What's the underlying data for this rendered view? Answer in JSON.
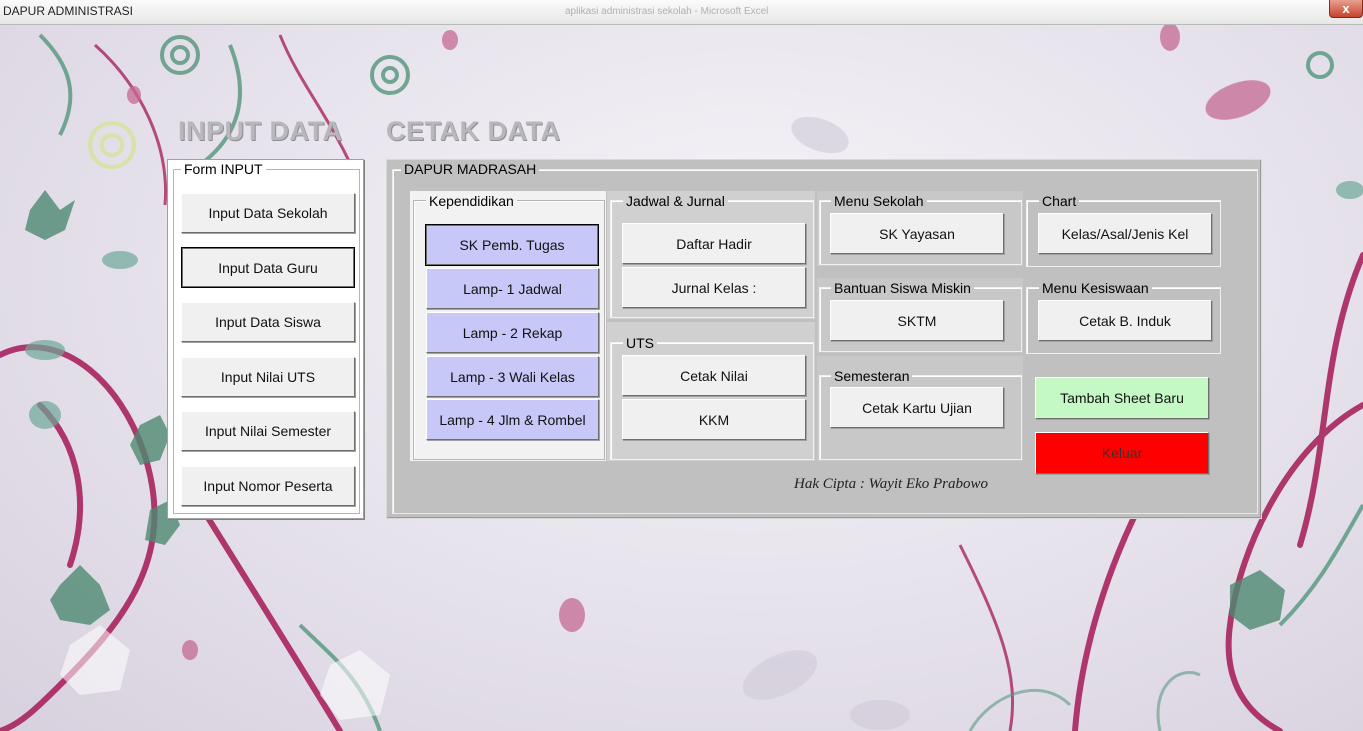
{
  "window": {
    "title": "DAPUR ADMINISTRASI",
    "faint_title": "aplikasi administrasi sekolah - Microsoft Excel",
    "close_glyph": "x"
  },
  "headers": {
    "input_data": "INPUT DATA",
    "cetak_data": "CETAK DATA"
  },
  "form_input": {
    "legend": "Form INPUT",
    "buttons": [
      "Input Data Sekolah",
      "Input Data Guru",
      "Input Data Siswa",
      "Input Nilai UTS",
      "Input Nilai Semester",
      "Input Nomor Peserta"
    ]
  },
  "dapur": {
    "legend": "DAPUR MADRASAH",
    "kependidikan": {
      "legend": "Kependidikan",
      "buttons": [
        "SK Pemb. Tugas",
        "Lamp- 1 Jadwal",
        "Lamp - 2 Rekap",
        "Lamp - 3 Wali Kelas",
        "Lamp - 4 Jlm & Rombel"
      ]
    },
    "jadwal": {
      "legend": "Jadwal & Jurnal",
      "buttons": [
        "Daftar Hadir",
        "Jurnal Kelas :"
      ]
    },
    "uts": {
      "legend": "UTS",
      "buttons": [
        "Cetak Nilai",
        "KKM"
      ]
    },
    "menu_sekolah": {
      "legend": "Menu Sekolah",
      "button": "SK Yayasan"
    },
    "chart": {
      "legend": "Chart",
      "button": "Kelas/Asal/Jenis Kel"
    },
    "bantuan": {
      "legend": "Bantuan Siswa Miskin",
      "button": "SKTM"
    },
    "kesiswaan": {
      "legend": "Menu Kesiswaan",
      "button": "Cetak B. Induk"
    },
    "semesteran": {
      "legend": "Semesteran",
      "button": "Cetak Kartu Ujian"
    },
    "tambah_sheet": "Tambah Sheet Baru",
    "keluar": "Keluar",
    "copyright": "Hak Cipta : Wayit Eko Prabowo"
  },
  "colors": {
    "purple_button": "#c8c8f8",
    "green_button": "#c4f8c4",
    "red_button": "#ff0000",
    "panel_gray": "#c0c0c0",
    "vine": "#a8245e",
    "leaf_green": "#5c9a82"
  }
}
